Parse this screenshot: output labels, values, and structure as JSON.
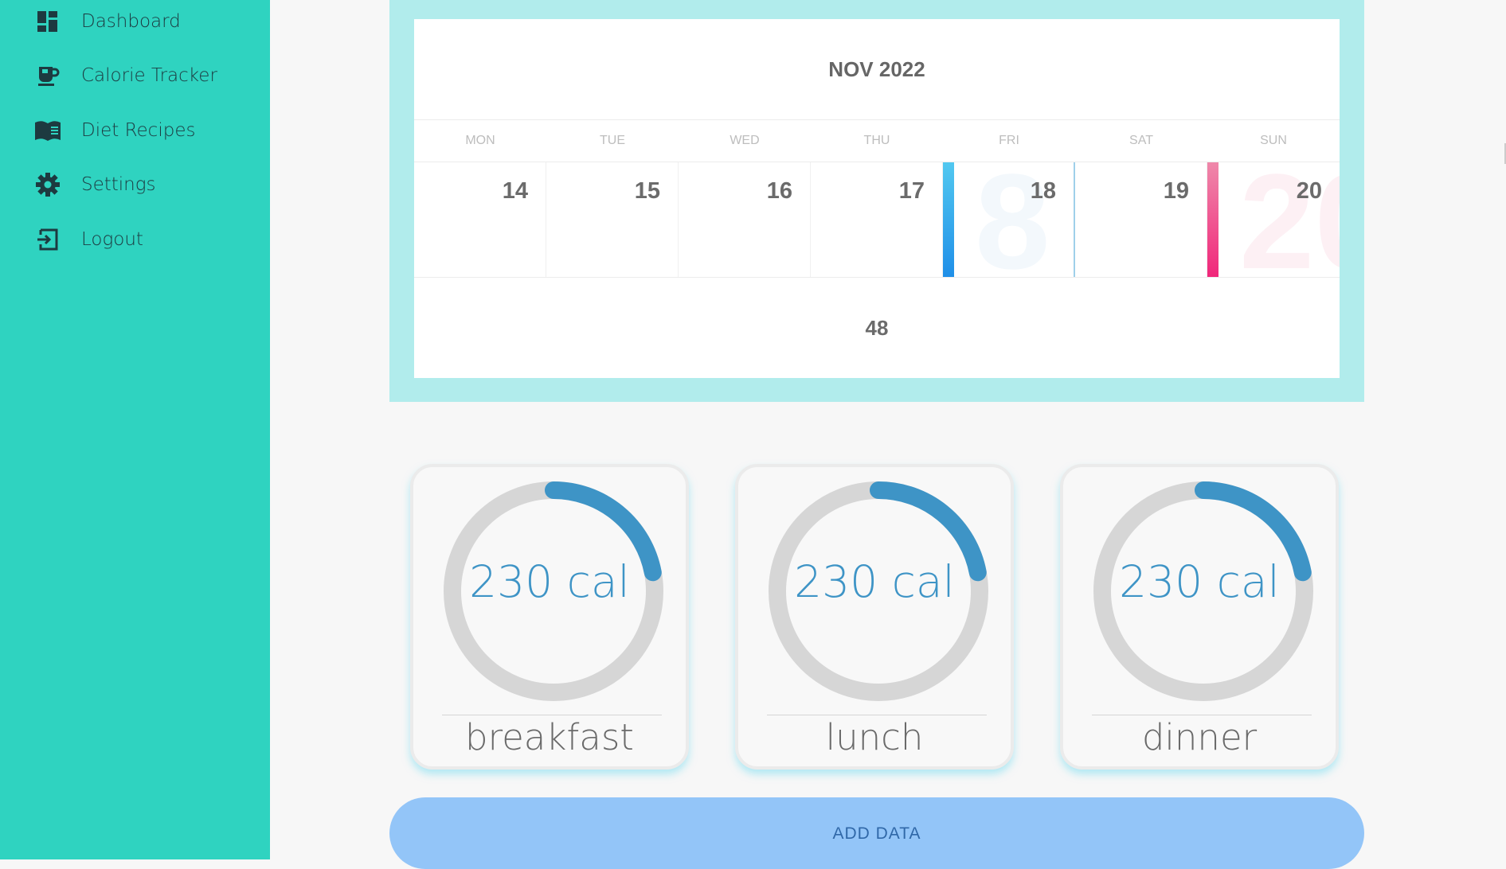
{
  "sidebar": {
    "items": [
      {
        "label": "Dashboard",
        "icon": "dashboard-icon"
      },
      {
        "label": "Calorie Tracker",
        "icon": "coffee-cup-icon"
      },
      {
        "label": "Diet Recipes",
        "icon": "book-icon"
      },
      {
        "label": "Settings",
        "icon": "gear-icon"
      },
      {
        "label": "Logout",
        "icon": "logout-icon"
      }
    ]
  },
  "calendar": {
    "month": "NOV 2022",
    "weekdays": [
      "MON",
      "TUE",
      "WED",
      "THU",
      "FRI",
      "SAT",
      "SUN"
    ],
    "days": [
      "14",
      "15",
      "16",
      "17",
      "18",
      "19",
      "20"
    ],
    "week_number": "48"
  },
  "meals": [
    {
      "value": "230 cal",
      "name": "breakfast",
      "progress": 0.22
    },
    {
      "value": "230 cal",
      "name": "lunch",
      "progress": 0.22
    },
    {
      "value": "230 cal",
      "name": "dinner",
      "progress": 0.22
    }
  ],
  "add_button": "ADD DATA",
  "colors": {
    "sidebar": "#2fd3c0",
    "calendar_frame": "#b1ecec",
    "ring_track": "#d6d6d6",
    "ring_progress": "#3e94c6",
    "today_marker": "#1f8fe8",
    "weekend_marker": "#f0277a",
    "button": "#93c5f8"
  }
}
